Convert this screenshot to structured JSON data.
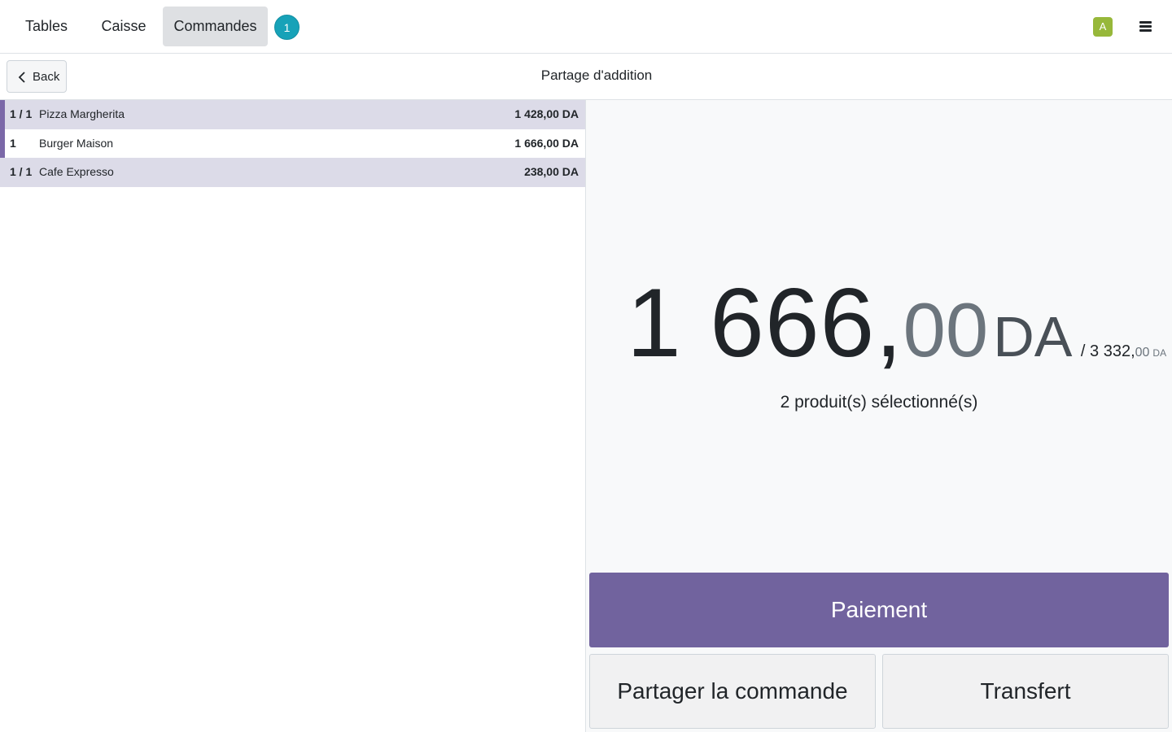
{
  "navbar": {
    "tabs": [
      {
        "label": "Tables"
      },
      {
        "label": "Caisse"
      },
      {
        "label": "Commandes"
      }
    ],
    "orders_badge": "1",
    "avatar_letter": "A",
    "active_tab": "Commandes"
  },
  "subheader": {
    "back_label": "Back",
    "title": "Partage d'addition"
  },
  "order_lines": [
    {
      "qty": "1 / 1",
      "name": "Pizza Margherita",
      "price": "1 428,00 DA",
      "highlighted": true,
      "selected": true
    },
    {
      "qty": "1",
      "name": "Burger Maison",
      "price": "1 666,00 DA",
      "highlighted": false,
      "selected": true
    },
    {
      "qty": "1 / 1",
      "name": "Cafe Expresso",
      "price": "238,00 DA",
      "highlighted": true,
      "selected": false
    }
  ],
  "summary": {
    "amount_int": "1 666,",
    "amount_dec": "00",
    "amount_currency": "DA",
    "total_prefix": "/ 3 332,",
    "total_dec": "00",
    "total_currency": "DA",
    "selected_text": "2 produit(s) sélectionné(s)"
  },
  "actions": {
    "payment_label": "Paiement",
    "split_label": "Partager la commande",
    "transfer_label": "Transfert"
  },
  "colors": {
    "accent": "#71639e",
    "row_highlight": "#dcdbe8",
    "badge": "#17a2b8",
    "avatar": "#97b83a"
  }
}
